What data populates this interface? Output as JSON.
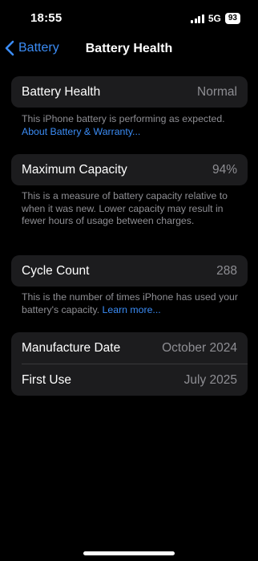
{
  "status_bar": {
    "time": "18:55",
    "network": "5G",
    "battery_level": "93"
  },
  "nav": {
    "back_label": "Battery",
    "title": "Battery Health"
  },
  "battery_health": {
    "label": "Battery Health",
    "value": "Normal",
    "footnote_text": "This iPhone battery is performing as expected. ",
    "footnote_link": "About Battery & Warranty..."
  },
  "maximum_capacity": {
    "label": "Maximum Capacity",
    "value": "94%",
    "footnote_text": "This is a measure of battery capacity relative to when it was new. Lower capacity may result in fewer hours of usage between charges."
  },
  "cycle_count": {
    "label": "Cycle Count",
    "value": "288",
    "footnote_text": "This is the number of times iPhone has used your battery's capacity. ",
    "footnote_link": "Learn more..."
  },
  "dates": {
    "manufacture_label": "Manufacture Date",
    "manufacture_value": "October 2024",
    "first_use_label": "First Use",
    "first_use_value": "July 2025"
  },
  "colors": {
    "accent": "#3b8cf5",
    "card_background": "#1c1c1e",
    "secondary_text": "#8e8e93"
  }
}
